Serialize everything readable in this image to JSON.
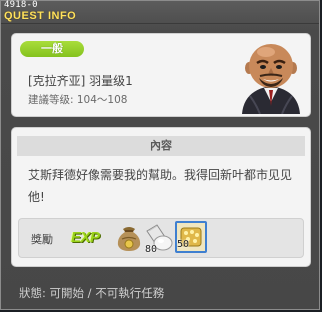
{
  "window": {
    "quest_id": "4918-0",
    "title": "QUEST INFO"
  },
  "info": {
    "category": "一般",
    "quest_name": "[克拉齐亚] 羽量级1",
    "required_level": "建議等级: 104～108"
  },
  "content": {
    "header": "內容",
    "text": "艾斯拜德好像需要我的幫助。我得回新叶都市见见他!"
  },
  "rewards": {
    "label": "獎勵",
    "exp_label": "EXP",
    "items": [
      {
        "icon": "meso-bag-icon",
        "count": ""
      },
      {
        "icon": "potion-scroll-icon",
        "count": "80"
      },
      {
        "icon": "gold-bag-icon",
        "count": "50"
      }
    ]
  },
  "status": {
    "text": "狀態: 可開始 / 不可執行任務"
  },
  "colors": {
    "title": "#ffe25e",
    "badge": "#94cc2a",
    "exp": "#9ad21a",
    "selection": "#3f7fd0"
  }
}
